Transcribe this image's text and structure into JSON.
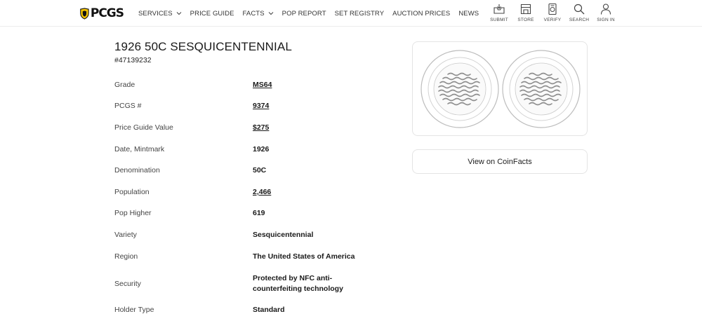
{
  "header": {
    "logo_text": "PCGS",
    "nav": [
      {
        "label": "SERVICES",
        "dropdown": true
      },
      {
        "label": "PRICE GUIDE",
        "dropdown": false
      },
      {
        "label": "FACTS",
        "dropdown": true
      },
      {
        "label": "POP REPORT",
        "dropdown": false
      },
      {
        "label": "SET REGISTRY",
        "dropdown": false
      },
      {
        "label": "AUCTION PRICES",
        "dropdown": false
      },
      {
        "label": "NEWS",
        "dropdown": false
      }
    ],
    "actions": [
      {
        "label": "SUBMIT",
        "icon": "submit-icon"
      },
      {
        "label": "STORE",
        "icon": "store-icon"
      },
      {
        "label": "VERIFY",
        "icon": "verify-icon"
      },
      {
        "label": "SEARCH",
        "icon": "search-icon"
      },
      {
        "label": "SIGN IN",
        "icon": "user-icon"
      }
    ]
  },
  "coin": {
    "title": "1926 50C SESQUICENTENNIAL",
    "cert_number": "#47139232"
  },
  "details": [
    {
      "label": "Grade",
      "value": "MS64",
      "link": true
    },
    {
      "label": "PCGS #",
      "value": "9374",
      "link": true
    },
    {
      "label": "Price Guide Value",
      "value": "$275",
      "link": true
    },
    {
      "label": "Date, Mintmark",
      "value": "1926",
      "link": false
    },
    {
      "label": "Denomination",
      "value": "50C",
      "link": false
    },
    {
      "label": "Population",
      "value": "2,466",
      "link": true
    },
    {
      "label": "Pop Higher",
      "value": "619",
      "link": false
    },
    {
      "label": "Variety",
      "value": "Sesquicentennial",
      "link": false
    },
    {
      "label": "Region",
      "value": "The United States of America",
      "link": false
    },
    {
      "label": "Security",
      "value": "Protected by NFC anti-counterfeiting technology",
      "link": false
    },
    {
      "label": "Holder Type",
      "value": "Standard",
      "link": false
    }
  ],
  "coinfacts_button": "View on CoinFacts",
  "colors": {
    "brand_yellow": "#f4c300",
    "text_dark": "#1a1a1a",
    "border": "#e4e4e4"
  }
}
